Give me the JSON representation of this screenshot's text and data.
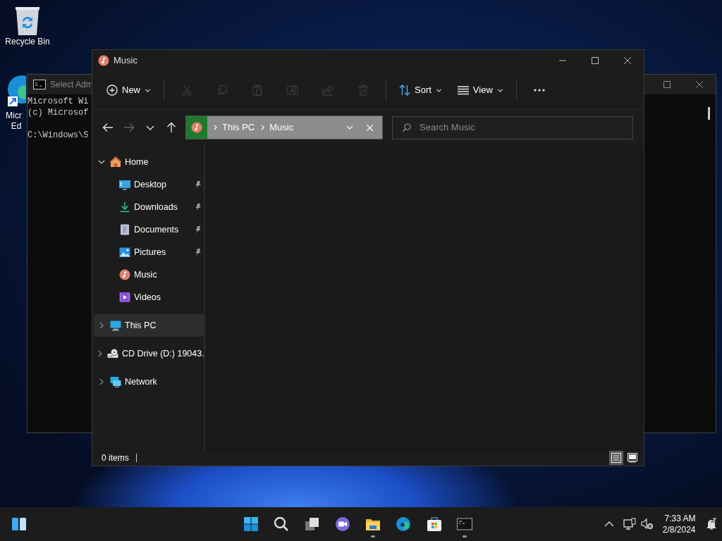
{
  "desktop_icons": [
    {
      "kind": "recycle",
      "lines": [
        "Recycle Bin"
      ]
    },
    {
      "kind": "edge",
      "lines": [
        "Micr",
        "Ed"
      ]
    }
  ],
  "console_window": {
    "title": "Select Adm",
    "lines": [
      "Microsoft Wi",
      "(c) Microsof",
      "C:\\Windows\\S"
    ]
  },
  "explorer": {
    "title": "Music",
    "toolbar": [
      {
        "kind": "new",
        "label": "New",
        "disabled": false
      },
      {
        "kind": "cut",
        "disabled": true
      },
      {
        "kind": "copy",
        "disabled": true
      },
      {
        "kind": "paste",
        "disabled": true
      },
      {
        "kind": "rename",
        "disabled": true
      },
      {
        "kind": "share",
        "disabled": true
      },
      {
        "kind": "delete",
        "disabled": true
      },
      {
        "kind": "sort",
        "label": "Sort",
        "disabled": false
      },
      {
        "kind": "view",
        "label": "View",
        "disabled": false
      },
      {
        "kind": "more",
        "disabled": false
      }
    ],
    "nav_buttons": [
      {
        "kind": "back",
        "disabled": false
      },
      {
        "kind": "forward",
        "disabled": true
      },
      {
        "kind": "recent",
        "disabled": false
      },
      {
        "kind": "up",
        "disabled": false
      }
    ],
    "address": {
      "segments": [
        "This PC",
        "Music"
      ]
    },
    "search": {
      "placeholder": "Search Music"
    },
    "nav_pane": [
      {
        "kind": "home",
        "label": "Home",
        "expanded": true,
        "selected": false,
        "children": [
          {
            "kind": "desktop",
            "label": "Desktop",
            "pinned": true,
            "selected": false
          },
          {
            "kind": "downloads",
            "label": "Downloads",
            "pinned": true,
            "selected": false
          },
          {
            "kind": "documents",
            "label": "Documents",
            "pinned": true,
            "selected": false
          },
          {
            "kind": "pictures",
            "label": "Pictures",
            "pinned": true,
            "selected": false
          },
          {
            "kind": "music",
            "label": "Music",
            "pinned": false,
            "selected": false
          },
          {
            "kind": "videos",
            "label": "Videos",
            "pinned": false,
            "selected": false
          }
        ]
      },
      {
        "kind": "pc",
        "label": "This PC",
        "expanded": false,
        "selected": true
      },
      {
        "kind": "cd",
        "label": "CD Drive (D:) 19043.",
        "expanded": false,
        "selected": false
      },
      {
        "kind": "network",
        "label": "Network",
        "expanded": false,
        "selected": false
      }
    ],
    "status": {
      "text": "0 items",
      "views": [
        {
          "kind": "details",
          "selected": true
        },
        {
          "kind": "tiles",
          "selected": false
        }
      ]
    }
  },
  "taskbar": {
    "apps": [
      {
        "kind": "widgets",
        "running": false
      },
      {
        "kind": "start",
        "running": false
      },
      {
        "kind": "search",
        "running": false
      },
      {
        "kind": "taskview",
        "running": false
      },
      {
        "kind": "chat",
        "running": false
      },
      {
        "kind": "files",
        "running": true
      },
      {
        "kind": "edge",
        "running": false
      },
      {
        "kind": "store",
        "running": false
      },
      {
        "kind": "terminal",
        "running": true
      }
    ],
    "tray": {
      "time": "7:33 AM",
      "date": "2/8/2024"
    }
  }
}
